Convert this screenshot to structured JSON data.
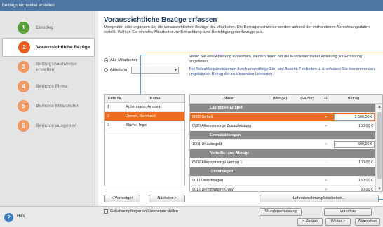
{
  "window": {
    "title": "Beitragsnachweise erstellen"
  },
  "sidebar": {
    "steps": [
      {
        "num": "1",
        "label": "Einstieg",
        "state": "done"
      },
      {
        "num": "2",
        "label": "Voraussichtliche Bezüge",
        "state": "active"
      },
      {
        "num": "3",
        "label": "Beitragsnachweise erstellen",
        "state": "todo"
      },
      {
        "num": "4",
        "label": "Berichte Firma",
        "state": "todo"
      },
      {
        "num": "5",
        "label": "Berichte Mitarbeiter",
        "state": "todo"
      },
      {
        "num": "6",
        "label": "Berichte ausgeben",
        "state": "todo"
      }
    ]
  },
  "main": {
    "title": "Voraussichtliche Bezüge erfassen",
    "intro": "Überprüfen oder ergänzen Sie die voraussichtlichen Bezüge der Mitarbeiter. Die Beitragsnachweise werden anhand der vorhandenen Abrechnungsdaten erstellt. Wählen Sie einzelne Mitarbeiter zur Betrachtung bzw. Berichtigung der Bezüge aus.",
    "radio_all": "Alle Mitarbeiter",
    "radio_dept": "Abteilung",
    "info1": "Wenn Sie eine Abteilung auswählen, werden Ihnen nur die Mitarbeiter dieser Abteilung zur Erfassung angeboten.",
    "info2": "Bei Teilzahlungszeiträumen durch unterjährige Ein- und Austritt, Fehlzeiten u. ä. erfassen Sie hier immer den ungekürzten Betrag der zu kürzenden Lohnarten.",
    "emp_headers": {
      "nr": "Pers.Nr.",
      "name": "Name"
    },
    "employees": [
      {
        "nr": "1",
        "name": "Achermann, Andrea"
      },
      {
        "nr": "2",
        "name": "Dieren, Bernhard"
      },
      {
        "nr": "3",
        "name": "Blume, Ingo"
      }
    ],
    "prev_button": "< Vorheriger",
    "next_button": "Nächster >",
    "checkbox_label": "Gehaltsempfänger an Listenende stellen",
    "pay_headers": {
      "lohnart": "Lohnart",
      "menge": "(Menge)",
      "faktor": "(Faktor)",
      "pm": "+/-",
      "betrag": "Betrag"
    },
    "pay_rows": [
      {
        "type": "section",
        "label": "Laufendes Entgelt"
      },
      {
        "type": "row",
        "label": "0002 Gehalt",
        "pm": "+",
        "betrag": "3.500,00 €",
        "selected": true
      },
      {
        "type": "row",
        "label": "0920 Altersvorsorge Zusatzleistung",
        "pm": "+",
        "betrag": "100,00 €"
      },
      {
        "type": "section",
        "label": "Einmalzahlungen"
      },
      {
        "type": "row",
        "label": "1001 Urlaubsgeld",
        "pm": "+",
        "betrag": "600,00 €"
      },
      {
        "type": "section",
        "label": "Netto Be- und Abzüge"
      },
      {
        "type": "row",
        "label": "6902 Altersvorsorge Vertrag 1",
        "pm": "-",
        "betrag": "100,00 €",
        "muted": true
      },
      {
        "type": "section",
        "label": "Dienstwagen"
      },
      {
        "type": "row",
        "label": "9011 Dienstwagen",
        "pm": "+",
        "betrag": "150,00 €"
      },
      {
        "type": "row",
        "label": "9012 Dienstwagen GWV",
        "pm": "+",
        "betrag": "90,00 €"
      }
    ],
    "lohnabrechnung_button": "Lohnabrechnung bearbeiten...",
    "stunden_button": "Stundenerfassung",
    "vorschau_button": "Vorschau"
  },
  "footer": {
    "help": "Hilfe",
    "back_button": "< Zurück",
    "next_button": "Weiter >",
    "cancel_button": "Abbrechen"
  },
  "colors": {
    "accent": "#ee6a1f",
    "done": "#5aa03a",
    "todo": "#f09a67",
    "heading": "#1f3e66",
    "titlebar": "#4f77a3"
  }
}
